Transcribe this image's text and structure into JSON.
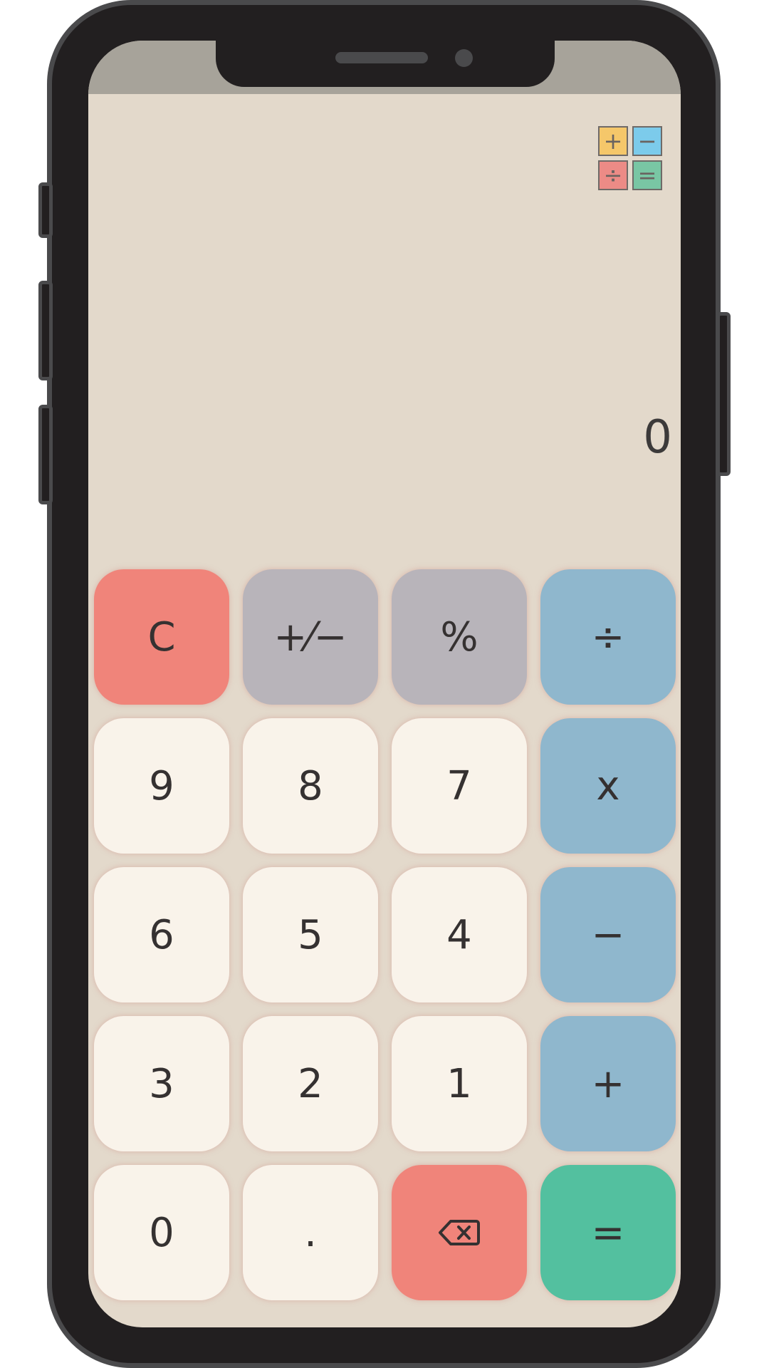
{
  "display": {
    "value": "0"
  },
  "theme_switch": {
    "cells": [
      {
        "symbol": "+",
        "color": "#f5c76a"
      },
      {
        "symbol": "−",
        "color": "#7ccbeb"
      },
      {
        "symbol": "÷",
        "color": "#ec8b86"
      },
      {
        "symbol": "=",
        "color": "#79c6a4"
      }
    ]
  },
  "keys": {
    "clear": "C",
    "sign": "+⁄−",
    "percent": "%",
    "divide": "÷",
    "nine": "9",
    "eight": "8",
    "seven": "7",
    "multiply": "x",
    "six": "6",
    "five": "5",
    "four": "4",
    "subtract": "−",
    "three": "3",
    "two": "2",
    "one": "1",
    "add": "+",
    "zero": "0",
    "decimal": ".",
    "equals": "="
  },
  "icons": {
    "backspace": "backspace-icon",
    "theme": "theme-switch-icon"
  },
  "colors": {
    "background": "#e3d9cb",
    "number_key": "#f9f3ea",
    "clear_key": "#f0847a",
    "utility_key": "#b8b4ba",
    "operator_key": "#8fb7cd",
    "equals_key": "#53c09f"
  }
}
